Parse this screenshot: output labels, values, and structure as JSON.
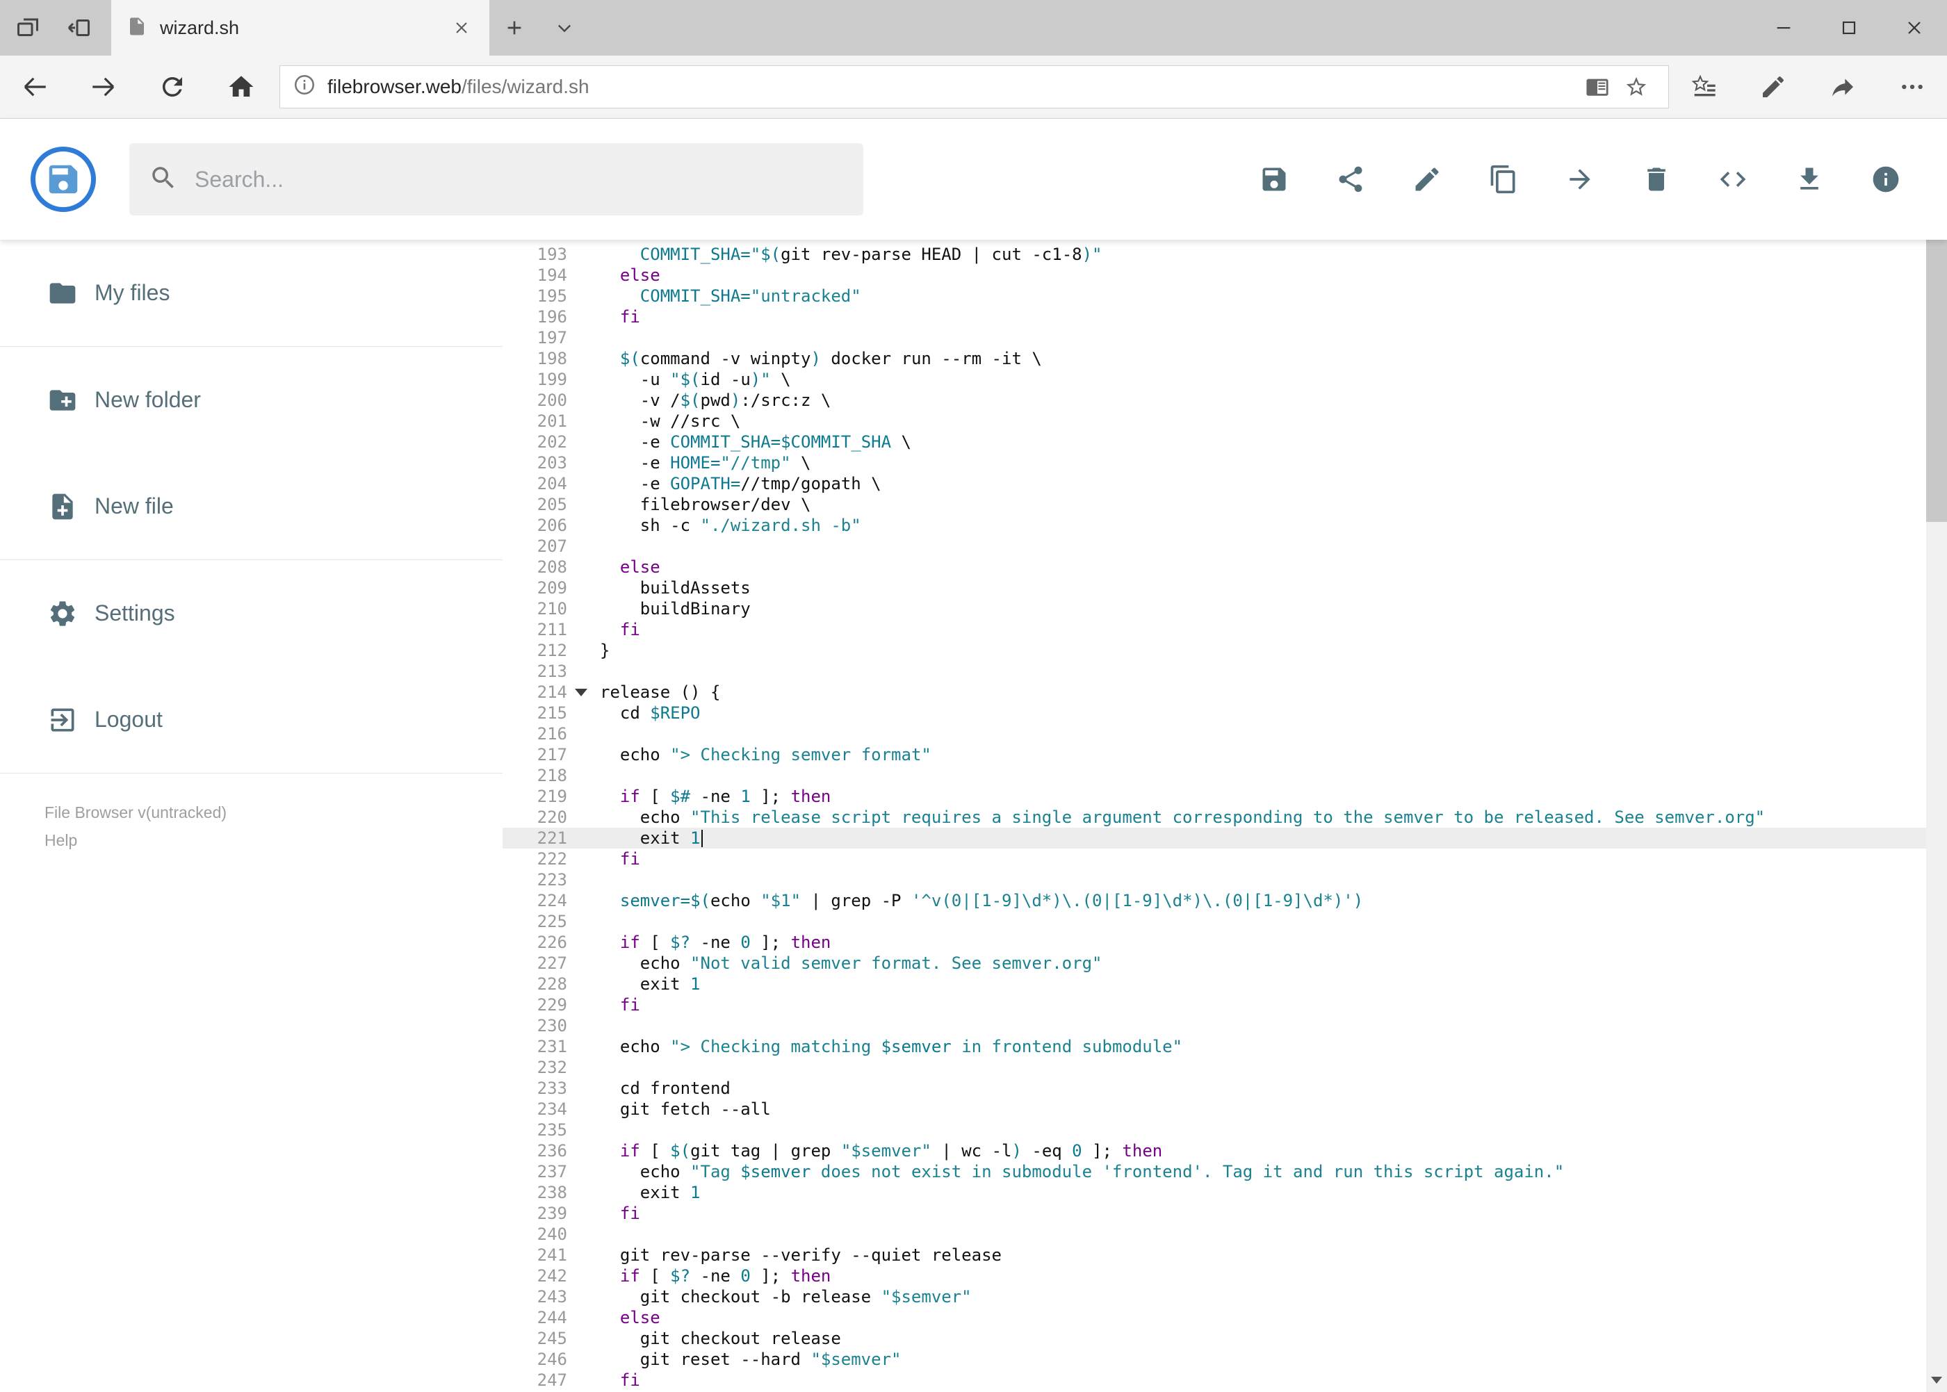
{
  "browser": {
    "tab_title": "wizard.sh",
    "url_domain": "filebrowser.web",
    "url_path": "/files/wizard.sh",
    "tabstrip_icons": [
      "tab-preview",
      "set-aside"
    ],
    "nav_icons": [
      "back",
      "forward",
      "refresh",
      "home"
    ],
    "urlbar_icons": [
      "reader",
      "star"
    ],
    "right_icons": [
      "hub",
      "pen",
      "share-page",
      "more"
    ],
    "window_controls": [
      "minimize",
      "maximize",
      "close"
    ]
  },
  "header": {
    "search_placeholder": "Search...",
    "toolbar_icons": [
      "save",
      "share",
      "edit",
      "copy",
      "move",
      "delete",
      "code",
      "download",
      "info"
    ]
  },
  "sidebar": {
    "items": [
      {
        "id": "my-files",
        "icon": "folder",
        "label": "My files",
        "divider_after": true
      },
      {
        "id": "new-folder",
        "icon": "new-folder",
        "label": "New folder",
        "divider_after": false
      },
      {
        "id": "new-file",
        "icon": "new-file",
        "label": "New file",
        "divider_after": true
      },
      {
        "id": "settings",
        "icon": "settings",
        "label": "Settings",
        "divider_after": false
      },
      {
        "id": "logout",
        "icon": "logout",
        "label": "Logout",
        "divider_after": true
      }
    ],
    "version": "File Browser v(untracked)",
    "help": "Help"
  },
  "editor": {
    "active_line": 221,
    "cursor_line": 221,
    "fold_marker_line": 214,
    "lines": [
      {
        "n": 193,
        "t": [
          [
            "p",
            "    "
          ],
          [
            "v",
            "COMMIT_SHA="
          ],
          [
            "s",
            "\""
          ],
          [
            "v",
            "$("
          ],
          [
            "p",
            "git rev-parse HEAD | cut -c1-8"
          ],
          [
            "v",
            ")"
          ],
          [
            "s",
            "\""
          ]
        ]
      },
      {
        "n": 194,
        "t": [
          [
            "p",
            "  "
          ],
          [
            "k",
            "else"
          ]
        ]
      },
      {
        "n": 195,
        "t": [
          [
            "p",
            "    "
          ],
          [
            "v",
            "COMMIT_SHA="
          ],
          [
            "s",
            "\"untracked\""
          ]
        ]
      },
      {
        "n": 196,
        "t": [
          [
            "p",
            "  "
          ],
          [
            "k",
            "fi"
          ]
        ]
      },
      {
        "n": 197,
        "t": []
      },
      {
        "n": 198,
        "t": [
          [
            "p",
            "  "
          ],
          [
            "v",
            "$("
          ],
          [
            "p",
            "command -v winpty"
          ],
          [
            "v",
            ")"
          ],
          [
            "p",
            " docker run --rm -it \\"
          ]
        ]
      },
      {
        "n": 199,
        "t": [
          [
            "p",
            "    -u "
          ],
          [
            "s",
            "\""
          ],
          [
            "v",
            "$("
          ],
          [
            "p",
            "id -u"
          ],
          [
            "v",
            ")"
          ],
          [
            "s",
            "\""
          ],
          [
            "p",
            " \\"
          ]
        ]
      },
      {
        "n": 200,
        "t": [
          [
            "p",
            "    -v /"
          ],
          [
            "v",
            "$("
          ],
          [
            "p",
            "pwd"
          ],
          [
            "v",
            ")"
          ],
          [
            "p",
            ":/src:z \\"
          ]
        ]
      },
      {
        "n": 201,
        "t": [
          [
            "p",
            "    -w //src \\"
          ]
        ]
      },
      {
        "n": 202,
        "t": [
          [
            "p",
            "    -e "
          ],
          [
            "v",
            "COMMIT_SHA=$COMMIT_SHA"
          ],
          [
            "p",
            " \\"
          ]
        ]
      },
      {
        "n": 203,
        "t": [
          [
            "p",
            "    -e "
          ],
          [
            "v",
            "HOME="
          ],
          [
            "s",
            "\"//tmp\""
          ],
          [
            "p",
            " \\"
          ]
        ]
      },
      {
        "n": 204,
        "t": [
          [
            "p",
            "    -e "
          ],
          [
            "v",
            "GOPATH="
          ],
          [
            "p",
            "//tmp/gopath \\"
          ]
        ]
      },
      {
        "n": 205,
        "t": [
          [
            "p",
            "    filebrowser/dev \\"
          ]
        ]
      },
      {
        "n": 206,
        "t": [
          [
            "p",
            "    sh -c "
          ],
          [
            "s",
            "\"./wizard.sh -b\""
          ]
        ]
      },
      {
        "n": 207,
        "t": []
      },
      {
        "n": 208,
        "t": [
          [
            "p",
            "  "
          ],
          [
            "k",
            "else"
          ]
        ]
      },
      {
        "n": 209,
        "t": [
          [
            "p",
            "    buildAssets"
          ]
        ]
      },
      {
        "n": 210,
        "t": [
          [
            "p",
            "    buildBinary"
          ]
        ]
      },
      {
        "n": 211,
        "t": [
          [
            "p",
            "  "
          ],
          [
            "k",
            "fi"
          ]
        ]
      },
      {
        "n": 212,
        "t": [
          [
            "p",
            "}"
          ]
        ]
      },
      {
        "n": 213,
        "t": []
      },
      {
        "n": 214,
        "t": [
          [
            "p",
            "release () {"
          ]
        ]
      },
      {
        "n": 215,
        "t": [
          [
            "p",
            "  cd "
          ],
          [
            "v",
            "$REPO"
          ]
        ]
      },
      {
        "n": 216,
        "t": []
      },
      {
        "n": 217,
        "t": [
          [
            "p",
            "  echo "
          ],
          [
            "s",
            "\"> Checking semver format\""
          ]
        ]
      },
      {
        "n": 218,
        "t": []
      },
      {
        "n": 219,
        "t": [
          [
            "p",
            "  "
          ],
          [
            "k",
            "if"
          ],
          [
            "p",
            " [ "
          ],
          [
            "v",
            "$#"
          ],
          [
            "p",
            " -ne "
          ],
          [
            "n",
            "1"
          ],
          [
            "p",
            " ]; "
          ],
          [
            "k",
            "then"
          ]
        ]
      },
      {
        "n": 220,
        "t": [
          [
            "p",
            "    echo "
          ],
          [
            "s",
            "\"This release script requires a single argument corresponding to the semver to be released. See semver.org\""
          ]
        ]
      },
      {
        "n": 221,
        "t": [
          [
            "p",
            "    exit "
          ],
          [
            "n",
            "1"
          ]
        ]
      },
      {
        "n": 222,
        "t": [
          [
            "p",
            "  "
          ],
          [
            "k",
            "fi"
          ]
        ]
      },
      {
        "n": 223,
        "t": []
      },
      {
        "n": 224,
        "t": [
          [
            "p",
            "  "
          ],
          [
            "v",
            "semver="
          ],
          [
            "v",
            "$("
          ],
          [
            "p",
            "echo "
          ],
          [
            "s",
            "\"$1\""
          ],
          [
            "p",
            " | grep -P "
          ],
          [
            "s",
            "'^v(0|[1-9]\\d*)\\.(0|[1-9]\\d*)\\.(0|[1-9]\\d*)'"
          ],
          [
            "v",
            ")"
          ]
        ]
      },
      {
        "n": 225,
        "t": []
      },
      {
        "n": 226,
        "t": [
          [
            "p",
            "  "
          ],
          [
            "k",
            "if"
          ],
          [
            "p",
            " [ "
          ],
          [
            "v",
            "$?"
          ],
          [
            "p",
            " -ne "
          ],
          [
            "n",
            "0"
          ],
          [
            "p",
            " ]; "
          ],
          [
            "k",
            "then"
          ]
        ]
      },
      {
        "n": 227,
        "t": [
          [
            "p",
            "    echo "
          ],
          [
            "s",
            "\"Not valid semver format. See semver.org\""
          ]
        ]
      },
      {
        "n": 228,
        "t": [
          [
            "p",
            "    exit "
          ],
          [
            "n",
            "1"
          ]
        ]
      },
      {
        "n": 229,
        "t": [
          [
            "p",
            "  "
          ],
          [
            "k",
            "fi"
          ]
        ]
      },
      {
        "n": 230,
        "t": []
      },
      {
        "n": 231,
        "t": [
          [
            "p",
            "  echo "
          ],
          [
            "s",
            "\"> Checking matching "
          ],
          [
            "v",
            "$semver"
          ],
          [
            "s",
            " in frontend submodule\""
          ]
        ]
      },
      {
        "n": 232,
        "t": []
      },
      {
        "n": 233,
        "t": [
          [
            "p",
            "  cd frontend"
          ]
        ]
      },
      {
        "n": 234,
        "t": [
          [
            "p",
            "  git fetch --all"
          ]
        ]
      },
      {
        "n": 235,
        "t": []
      },
      {
        "n": 236,
        "t": [
          [
            "p",
            "  "
          ],
          [
            "k",
            "if"
          ],
          [
            "p",
            " [ "
          ],
          [
            "v",
            "$("
          ],
          [
            "p",
            "git tag | grep "
          ],
          [
            "s",
            "\"$semver\""
          ],
          [
            "p",
            " | wc -l"
          ],
          [
            "v",
            ")"
          ],
          [
            "p",
            " -eq "
          ],
          [
            "n",
            "0"
          ],
          [
            "p",
            " ]; "
          ],
          [
            "k",
            "then"
          ]
        ]
      },
      {
        "n": 237,
        "t": [
          [
            "p",
            "    echo "
          ],
          [
            "s",
            "\"Tag "
          ],
          [
            "v",
            "$semver"
          ],
          [
            "s",
            " does not exist in submodule 'frontend'. Tag it and run this script again.\""
          ]
        ]
      },
      {
        "n": 238,
        "t": [
          [
            "p",
            "    exit "
          ],
          [
            "n",
            "1"
          ]
        ]
      },
      {
        "n": 239,
        "t": [
          [
            "p",
            "  "
          ],
          [
            "k",
            "fi"
          ]
        ]
      },
      {
        "n": 240,
        "t": []
      },
      {
        "n": 241,
        "t": [
          [
            "p",
            "  git rev-parse --verify --quiet release"
          ]
        ]
      },
      {
        "n": 242,
        "t": [
          [
            "p",
            "  "
          ],
          [
            "k",
            "if"
          ],
          [
            "p",
            " [ "
          ],
          [
            "v",
            "$?"
          ],
          [
            "p",
            " -ne "
          ],
          [
            "n",
            "0"
          ],
          [
            "p",
            " ]; "
          ],
          [
            "k",
            "then"
          ]
        ]
      },
      {
        "n": 243,
        "t": [
          [
            "p",
            "    git checkout -b release "
          ],
          [
            "s",
            "\"$semver\""
          ]
        ]
      },
      {
        "n": 244,
        "t": [
          [
            "p",
            "  "
          ],
          [
            "k",
            "else"
          ]
        ]
      },
      {
        "n": 245,
        "t": [
          [
            "p",
            "    git checkout release"
          ]
        ]
      },
      {
        "n": 246,
        "t": [
          [
            "p",
            "    git reset --hard "
          ],
          [
            "s",
            "\"$semver\""
          ]
        ]
      },
      {
        "n": 247,
        "t": [
          [
            "p",
            "  "
          ],
          [
            "k",
            "fi"
          ]
        ]
      }
    ]
  },
  "colors": {
    "accent": "#2f7cd8",
    "keyword": "#770088",
    "string": "#1a8291",
    "variable": "#0e7a8f",
    "active_line_bg": "#ededed"
  }
}
